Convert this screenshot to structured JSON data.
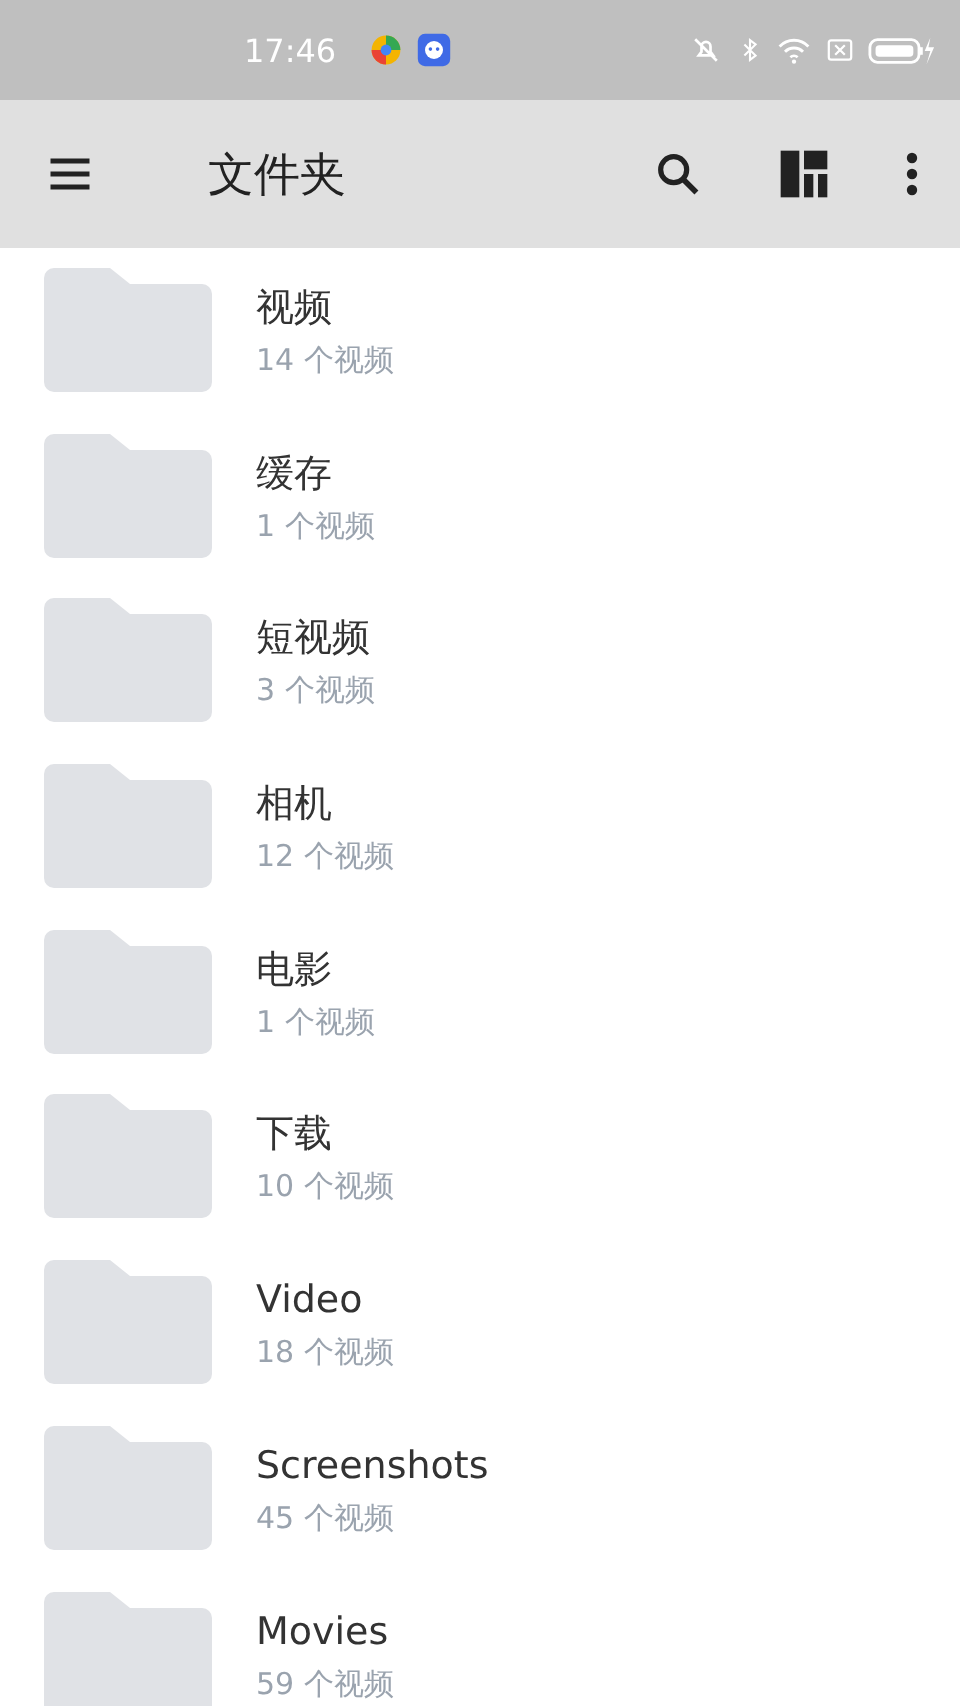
{
  "status_bar": {
    "time": "17:46"
  },
  "toolbar": {
    "title": "文件夹"
  },
  "folders": [
    {
      "name": "视频",
      "count": "14 个视频"
    },
    {
      "name": "缓存",
      "count": "1 个视频"
    },
    {
      "name": "短视频",
      "count": "3 个视频"
    },
    {
      "name": "相机",
      "count": "12 个视频"
    },
    {
      "name": "电影",
      "count": "1 个视频"
    },
    {
      "name": "下载",
      "count": "10 个视频"
    },
    {
      "name": "Video",
      "count": "18 个视频"
    },
    {
      "name": "Screenshots",
      "count": "45 个视频"
    },
    {
      "name": "Movies",
      "count": "59 个视频"
    }
  ]
}
